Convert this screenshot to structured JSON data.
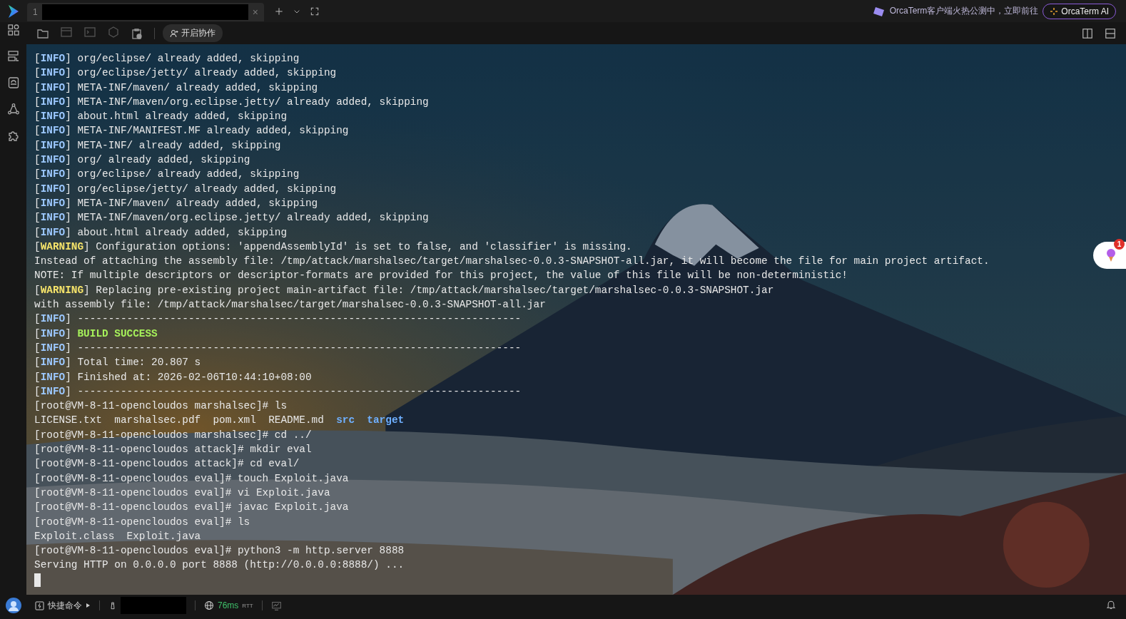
{
  "tabs": [
    {
      "number": "1",
      "selected": true,
      "close": "×"
    }
  ],
  "toolbar": {
    "collab_button": "开启协作"
  },
  "promo": {
    "text": "OrcaTerm客户端火热公测中，立即前往",
    "ai_button": "OrcaTerm AI"
  },
  "sidebar": {
    "items": [
      {
        "kind": "grid"
      },
      {
        "kind": "list"
      },
      {
        "kind": "drive"
      },
      {
        "kind": "nodes"
      },
      {
        "kind": "puzzle"
      }
    ]
  },
  "terminal": {
    "lines": [
      [
        {
          "kind": "plain",
          "text": "["
        },
        {
          "kind": "info",
          "text": "INFO"
        },
        {
          "kind": "plain",
          "text": "] org/eclipse/ already added, skipping"
        }
      ],
      [
        {
          "kind": "plain",
          "text": "["
        },
        {
          "kind": "info",
          "text": "INFO"
        },
        {
          "kind": "plain",
          "text": "] org/eclipse/jetty/ already added, skipping"
        }
      ],
      [
        {
          "kind": "plain",
          "text": "["
        },
        {
          "kind": "info",
          "text": "INFO"
        },
        {
          "kind": "plain",
          "text": "] META-INF/maven/ already added, skipping"
        }
      ],
      [
        {
          "kind": "plain",
          "text": "["
        },
        {
          "kind": "info",
          "text": "INFO"
        },
        {
          "kind": "plain",
          "text": "] META-INF/maven/org.eclipse.jetty/ already added, skipping"
        }
      ],
      [
        {
          "kind": "plain",
          "text": "["
        },
        {
          "kind": "info",
          "text": "INFO"
        },
        {
          "kind": "plain",
          "text": "] about.html already added, skipping"
        }
      ],
      [
        {
          "kind": "plain",
          "text": "["
        },
        {
          "kind": "info",
          "text": "INFO"
        },
        {
          "kind": "plain",
          "text": "] META-INF/MANIFEST.MF already added, skipping"
        }
      ],
      [
        {
          "kind": "plain",
          "text": "["
        },
        {
          "kind": "info",
          "text": "INFO"
        },
        {
          "kind": "plain",
          "text": "] META-INF/ already added, skipping"
        }
      ],
      [
        {
          "kind": "plain",
          "text": "["
        },
        {
          "kind": "info",
          "text": "INFO"
        },
        {
          "kind": "plain",
          "text": "] org/ already added, skipping"
        }
      ],
      [
        {
          "kind": "plain",
          "text": "["
        },
        {
          "kind": "info",
          "text": "INFO"
        },
        {
          "kind": "plain",
          "text": "] org/eclipse/ already added, skipping"
        }
      ],
      [
        {
          "kind": "plain",
          "text": "["
        },
        {
          "kind": "info",
          "text": "INFO"
        },
        {
          "kind": "plain",
          "text": "] org/eclipse/jetty/ already added, skipping"
        }
      ],
      [
        {
          "kind": "plain",
          "text": "["
        },
        {
          "kind": "info",
          "text": "INFO"
        },
        {
          "kind": "plain",
          "text": "] META-INF/maven/ already added, skipping"
        }
      ],
      [
        {
          "kind": "plain",
          "text": "["
        },
        {
          "kind": "info",
          "text": "INFO"
        },
        {
          "kind": "plain",
          "text": "] META-INF/maven/org.eclipse.jetty/ already added, skipping"
        }
      ],
      [
        {
          "kind": "plain",
          "text": "["
        },
        {
          "kind": "info",
          "text": "INFO"
        },
        {
          "kind": "plain",
          "text": "] about.html already added, skipping"
        }
      ],
      [
        {
          "kind": "plain",
          "text": "["
        },
        {
          "kind": "warning",
          "text": "WARNING"
        },
        {
          "kind": "plain",
          "text": "] Configuration options: 'appendAssemblyId' is set to false, and 'classifier' is missing."
        }
      ],
      [
        {
          "kind": "plain",
          "text": "Instead of attaching the assembly file: /tmp/attack/marshalsec/target/marshalsec-0.0.3-SNAPSHOT-all.jar, it will become the file for main project artifact."
        }
      ],
      [
        {
          "kind": "plain",
          "text": "NOTE: If multiple descriptors or descriptor-formats are provided for this project, the value of this file will be non-deterministic!"
        }
      ],
      [
        {
          "kind": "plain",
          "text": "["
        },
        {
          "kind": "warning",
          "text": "WARNING"
        },
        {
          "kind": "plain",
          "text": "] Replacing pre-existing project main-artifact file: /tmp/attack/marshalsec/target/marshalsec-0.0.3-SNAPSHOT.jar"
        }
      ],
      [
        {
          "kind": "plain",
          "text": "with assembly file: /tmp/attack/marshalsec/target/marshalsec-0.0.3-SNAPSHOT-all.jar"
        }
      ],
      [
        {
          "kind": "plain",
          "text": "["
        },
        {
          "kind": "info",
          "text": "INFO"
        },
        {
          "kind": "plain",
          "text": "] ------------------------------------------------------------------------"
        }
      ],
      [
        {
          "kind": "plain",
          "text": "["
        },
        {
          "kind": "info",
          "text": "INFO"
        },
        {
          "kind": "plain",
          "text": "] "
        },
        {
          "kind": "success",
          "text": "BUILD SUCCESS"
        }
      ],
      [
        {
          "kind": "plain",
          "text": "["
        },
        {
          "kind": "info",
          "text": "INFO"
        },
        {
          "kind": "plain",
          "text": "] ------------------------------------------------------------------------"
        }
      ],
      [
        {
          "kind": "plain",
          "text": "["
        },
        {
          "kind": "info",
          "text": "INFO"
        },
        {
          "kind": "plain",
          "text": "] Total time: 20.807 s"
        }
      ],
      [
        {
          "kind": "plain",
          "text": "["
        },
        {
          "kind": "info",
          "text": "INFO"
        },
        {
          "kind": "plain",
          "text": "] Finished at: 2026-02-06T10:44:10+08:00"
        }
      ],
      [
        {
          "kind": "plain",
          "text": "["
        },
        {
          "kind": "info",
          "text": "INFO"
        },
        {
          "kind": "plain",
          "text": "] ------------------------------------------------------------------------"
        }
      ],
      [
        {
          "kind": "plain",
          "text": "[root@VM-8-11-opencloudos marshalsec]# ls"
        }
      ],
      [
        {
          "kind": "plain",
          "text": "LICENSE.txt  marshalsec.pdf  pom.xml  README.md  "
        },
        {
          "kind": "dir",
          "text": "src"
        },
        {
          "kind": "dir",
          "text": "  target"
        }
      ],
      [
        {
          "kind": "plain",
          "text": "[root@VM-8-11-opencloudos marshalsec]# cd ../"
        }
      ],
      [
        {
          "kind": "plain",
          "text": "[root@VM-8-11-opencloudos attack]# mkdir eval"
        }
      ],
      [
        {
          "kind": "plain",
          "text": "[root@VM-8-11-opencloudos attack]# cd eval/"
        }
      ],
      [
        {
          "kind": "plain",
          "text": "[root@VM-8-11-opencloudos eval]# touch Exploit.java"
        }
      ],
      [
        {
          "kind": "plain",
          "text": "[root@VM-8-11-opencloudos eval]# vi Exploit.java"
        }
      ],
      [
        {
          "kind": "plain",
          "text": "[root@VM-8-11-opencloudos eval]# javac Exploit.java"
        }
      ],
      [
        {
          "kind": "plain",
          "text": "[root@VM-8-11-opencloudos eval]# ls"
        }
      ],
      [
        {
          "kind": "plain",
          "text": "Exploit.class  Exploit.java"
        }
      ],
      [
        {
          "kind": "plain",
          "text": "[root@VM-8-11-opencloudos eval]# python3 -m http.server 8888"
        }
      ],
      [
        {
          "kind": "plain",
          "text": "Serving HTTP on 0.0.0.0 port 8888 (http://0.0.0.0:8888/) ..."
        }
      ]
    ],
    "background": {
      "kind": "picture"
    }
  },
  "floating_badge": "1",
  "status_bar": {
    "quick_commands": "快捷命令",
    "latency": "76ms",
    "latency_unit": "RTT"
  }
}
